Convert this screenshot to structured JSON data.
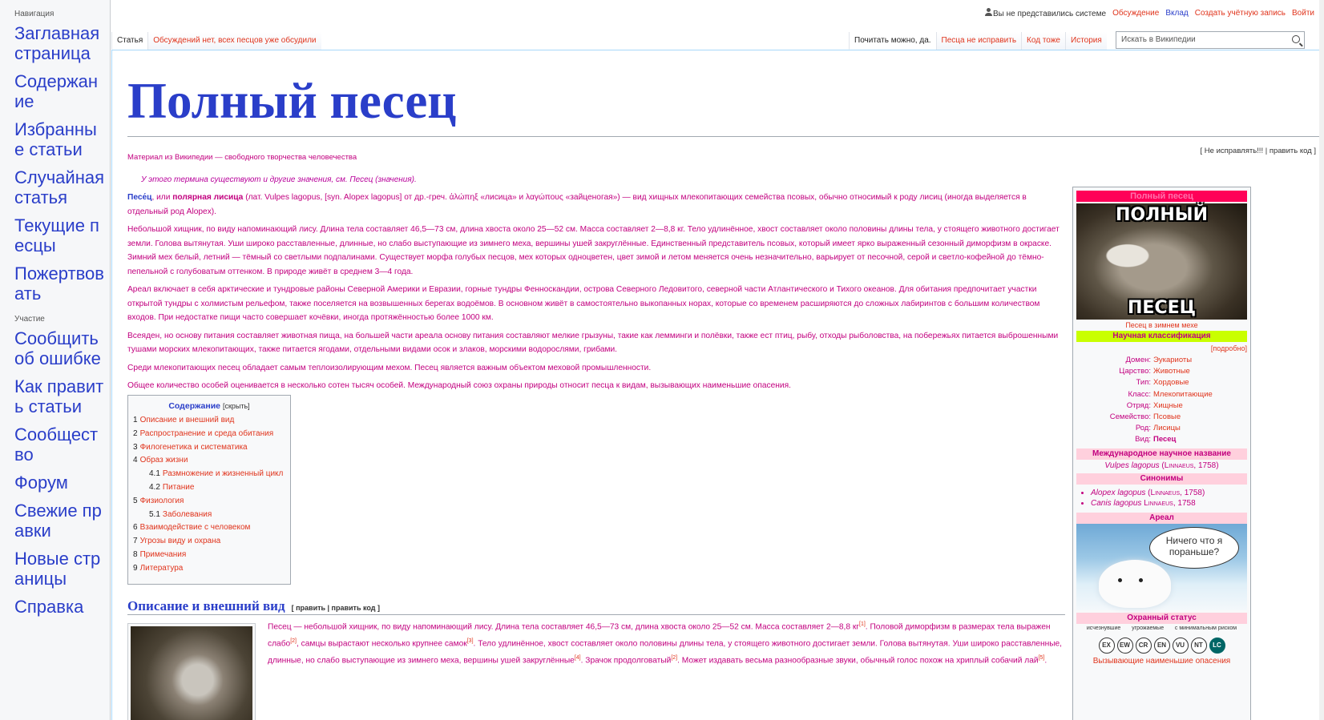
{
  "sidebar": {
    "nav_head": "Навигация",
    "nav": [
      "Заглавная страница",
      "Содержание",
      "Избранные статьи",
      "Случайная статья",
      "Текущие песцы",
      "Пожертвовать"
    ],
    "part_head": "Участие",
    "part": [
      "Сообщить об ошибке",
      "Как править статьи",
      "Сообщество",
      "Форум",
      "Свежие правки",
      "Новые страницы",
      "Справка"
    ]
  },
  "personal": {
    "not_logged": "Вы не представились системе",
    "talk": "Обсуждение",
    "contrib": "Вклад",
    "create": "Создать учётную запись",
    "login": "Войти"
  },
  "tabs": {
    "article": "Статья",
    "discussion": "Обсуждений нет, всех песцов уже обсудили",
    "read": "Почитать можно, да.",
    "edit": "Песца не исправить",
    "code": "Код тоже",
    "history": "История"
  },
  "search": {
    "placeholder": "Искать в Википедии"
  },
  "page": {
    "title": "Полный песец",
    "tagline": "Материал из Википедии — свободного творчества человечества",
    "top_edit": "[ Не исправлять!!! | править код ]",
    "hatnote": "У этого термина существуют и другие значения, см. Песец (значения)."
  },
  "lead": {
    "p1_a": "Песе́ц",
    "p1_b": ", или ",
    "p1_c": "полярная лисица",
    "p1_d": " (лат. Vulpes lagopus, [syn. Alopex lagopus] от др.-греч. ἀλώπηξ «лисица» и λαγώπους «зайценогая») — вид хищных млекопитающих семейства псовых, обычно относимый к роду лисиц (иногда выделяется в отдельный род Alopex).",
    "p2": "Небольшой хищник, по виду напоминающий лису. Длина тела составляет 46,5—73 см, длина хвоста около 25—52 см. Масса составляет 2—8,8 кг. Тело удлинённое, хвост составляет около половины длины тела, у стоящего животного достигает земли. Голова вытянутая. Уши широко расставленные, длинные, но слабо выступающие из зимнего меха, вершины ушей закруглённые. Единственный представитель псовых, который имеет ярко выраженный сезонный диморфизм в окраске. Зимний мех белый, летний — тёмный со светлыми подпалинами. Существует морфа голубых песцов, мех которых одноцветен, цвет зимой и летом меняется очень незначительно, варьирует от песочной, серой и светло-кофейной до тёмно-пепельной с голубоватым оттенком. В природе живёт в среднем 3—4 года.",
    "p3": "Ареал включает в себя арктические и тундровые районы Северной Америки и Евразии, горные тундры Фенноскандии, острова Северного Ледовитого, северной части Атлантического и Тихого океанов. Для обитания предпочитает участки открытой тундры с холмистым рельефом, также поселяется на возвышенных берегах водоёмов. В основном живёт в самостоятельно выкопанных норах, которые со временем расширяются до сложных лабиринтов с большим количеством входов. При недостатке пищи часто совершает кочёвки, иногда протяжённостью более 1000 км.",
    "p4": "Всеяден, но основу питания составляет животная пища, на большей части ареала основу питания составляют мелкие грызуны, такие как лемминги и полёвки, также ест птиц, рыбу, отходы рыболовства, на побережьях питается выброшенными тушами морских млекопитающих, также питается ягодами, отдельными видами осок и злаков, морскими водорослями, грибами.",
    "p5": "Среди млекопитающих песец обладает самым теплоизолирующим мехом. Песец является важным объектом меховой промышленности.",
    "p6": "Общее количество особей оценивается в несколько сотен тысяч особей. Международный союз охраны природы относит песца к видам, вызывающих наименьшие опасения."
  },
  "toc": {
    "title": "Содержание",
    "hide": "[скрыть]",
    "items": [
      {
        "n": "1",
        "t": "Описание и внешний вид",
        "sub": false
      },
      {
        "n": "2",
        "t": "Распространение и среда обитания",
        "sub": false
      },
      {
        "n": "3",
        "t": "Филогенетика и систематика",
        "sub": false
      },
      {
        "n": "4",
        "t": "Образ жизни",
        "sub": false
      },
      {
        "n": "4.1",
        "t": "Размножение и жизненный цикл",
        "sub": true
      },
      {
        "n": "4.2",
        "t": "Питание",
        "sub": true
      },
      {
        "n": "5",
        "t": "Физиология",
        "sub": false
      },
      {
        "n": "5.1",
        "t": "Заболевания",
        "sub": true
      },
      {
        "n": "6",
        "t": "Взаимодействие с человеком",
        "sub": false
      },
      {
        "n": "7",
        "t": "Угрозы виду и охрана",
        "sub": false
      },
      {
        "n": "8",
        "t": "Примечания",
        "sub": false
      },
      {
        "n": "9",
        "t": "Литература",
        "sub": false
      }
    ]
  },
  "section": {
    "heading": "Описание и внешний вид",
    "edit": "[ править | править код ]",
    "text1": "Песец — небольшой хищник, по виду напоминающий лису. Длина тела составляет 46,5—73 см, длина хвоста около 25—52 см. Масса составляет 2—8,8 кг",
    "ref1": "[1]",
    "text2": ". Половой диморфизм в размерах тела выражен слабо",
    "ref2": "[2]",
    "text3": ", самцы вырастают несколько крупнее самок",
    "ref3": "[3]",
    "text4": ". Тело удлинённое, хвост составляет около половины длины тела, у стоящего животного достигает земли. Голова вытянутая. Уши широко расставленные, длинные, но слабо выступающие из зимнего меха, вершины ушей закруглённые",
    "ref4": "[4]",
    "text5": ". Зрачок продолговатый",
    "ref5": "[2]",
    "text6": ". Может издавать весьма разнообразные звуки, обычный голос похож на хриплый собачий лай",
    "ref6": "[5]",
    "text7": "."
  },
  "infobox": {
    "head": "Полный песец",
    "meme_top": "ПОЛНЫЙ",
    "meme_bottom": "ПЕСЕЦ",
    "caption": "Песец в зимнем мехе",
    "class_head": "Научная классификация",
    "more": "[подробно]",
    "taxa": [
      {
        "k": "Домен:",
        "v": "Эукариоты"
      },
      {
        "k": "Царство:",
        "v": "Животные"
      },
      {
        "k": "Тип:",
        "v": "Хордовые"
      },
      {
        "k": "Класс:",
        "v": "Млекопитающие"
      },
      {
        "k": "Отряд:",
        "v": "Хищные"
      },
      {
        "k": "Семейство:",
        "v": "Псовые"
      },
      {
        "k": "Род:",
        "v": "Лисицы"
      },
      {
        "k": "Вид:",
        "v": "Песец"
      }
    ],
    "intl_head": "Международное научное название",
    "intl_name": "Vulpes lagopus",
    "intl_auth": "(Linnaeus, 1758)",
    "syn_head": "Синонимы",
    "syn1_name": "Alopex lagopus",
    "syn1_auth": "(Linnaeus, 1758)",
    "syn2_name": "Canis lagopus",
    "syn2_auth": "Linnaeus, 1758",
    "range_head": "Ареал",
    "bubble": "Ничего что я пораньше?",
    "status_head": "Охранный статус",
    "scale_labels": [
      "исчезнувшие",
      "угрожаемые",
      "с минимальным риском"
    ],
    "scale": [
      "EX",
      "EW",
      "CR",
      "EN",
      "VU",
      "NT",
      "LC"
    ],
    "status_bottom": "Вызывающие наименьшие опасения"
  }
}
